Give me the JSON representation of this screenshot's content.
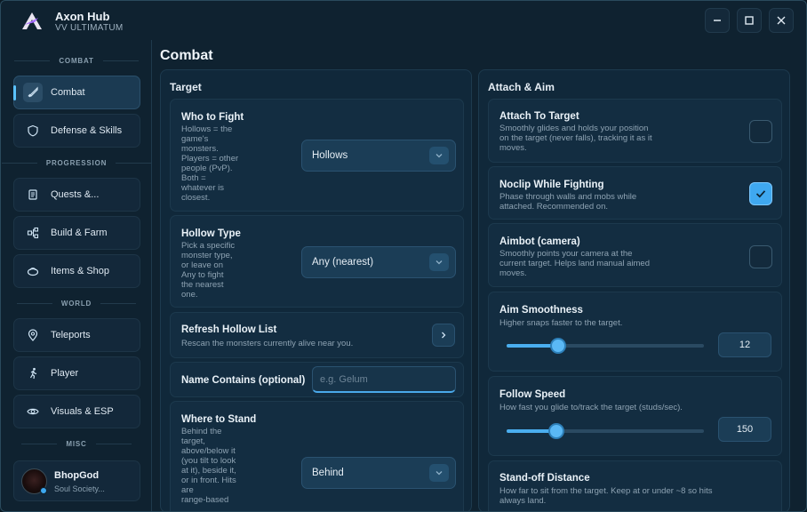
{
  "app": {
    "title": "Axon Hub",
    "subtitle": "VV ULTIMATUM"
  },
  "window_controls": {
    "minimize_icon": "minimize-icon",
    "maximize_icon": "maximize-icon",
    "close_icon": "close-icon"
  },
  "sidebar": {
    "sections": {
      "combat": "COMBAT",
      "progression": "PROGRESSION",
      "world": "WORLD",
      "misc": "MISC"
    },
    "items": [
      {
        "label": "Combat",
        "icon": "sword-icon",
        "active": true
      },
      {
        "label": "Defense & Skills",
        "icon": "shield-icon"
      },
      {
        "label": "Quests &...",
        "icon": "scroll-icon"
      },
      {
        "label": "Build & Farm",
        "icon": "nodes-icon"
      },
      {
        "label": "Items & Shop",
        "icon": "bag-icon"
      },
      {
        "label": "Teleports",
        "icon": "map-pin-icon"
      },
      {
        "label": "Player",
        "icon": "running-icon"
      },
      {
        "label": "Visuals & ESP",
        "icon": "eye-icon"
      }
    ],
    "user": {
      "name": "BhopGod",
      "subtitle": "Soul Society..."
    }
  },
  "page": {
    "title": "Combat"
  },
  "target_panel": {
    "title": "Target",
    "who_to_fight": {
      "title": "Who to Fight",
      "desc": [
        "Hollows = the",
        "game's",
        "monsters.",
        "Players = other",
        "people (PvP).",
        "Both =",
        "whatever is",
        "closest."
      ],
      "value": "Hollows"
    },
    "hollow_type": {
      "title": "Hollow Type",
      "desc": [
        "Pick a specific",
        "monster type,",
        "or leave on",
        "Any to fight",
        "the nearest",
        "one."
      ],
      "value": "Any (nearest)"
    },
    "refresh": {
      "title": "Refresh Hollow List",
      "desc": "Rescan the monsters currently alive near you."
    },
    "name_contains": {
      "title": "Name Contains (optional)",
      "placeholder": "e.g. Gelum",
      "value": ""
    },
    "where_to_stand": {
      "title": "Where to Stand",
      "desc": [
        "Behind the",
        "target,",
        "above/below it",
        "(you tilt to look",
        "at it), beside it,",
        "or in front. Hits",
        "are",
        "range-based"
      ],
      "value": "Behind"
    }
  },
  "attach_panel": {
    "title": "Attach & Aim",
    "attach_to_target": {
      "title": "Attach To Target",
      "desc": [
        "Smoothly glides and holds your position",
        "on the target (never falls), tracking it as it",
        "moves."
      ],
      "checked": false
    },
    "noclip": {
      "title": "Noclip While Fighting",
      "desc": [
        "Phase through walls and mobs while",
        "attached. Recommended on."
      ],
      "checked": true
    },
    "aimbot": {
      "title": "Aimbot (camera)",
      "desc": [
        "Smoothly points your camera at the",
        "current target. Helps land manual aimed",
        "moves."
      ],
      "checked": false
    },
    "aim_smoothness": {
      "title": "Aim Smoothness",
      "desc": "Higher snaps faster to the target.",
      "value": "12",
      "fraction": 0.26
    },
    "follow_speed": {
      "title": "Follow Speed",
      "desc": "How fast you glide to/track the target (studs/sec).",
      "value": "150",
      "fraction": 0.25
    },
    "standoff": {
      "title": "Stand-off Distance",
      "desc": [
        "How far to sit from the target. Keep at or under ~8 so hits",
        "always land."
      ]
    }
  },
  "colors": {
    "accent": "#4aaeef",
    "background": "#0f2230",
    "panel": "#10283a",
    "card": "#132d41"
  }
}
